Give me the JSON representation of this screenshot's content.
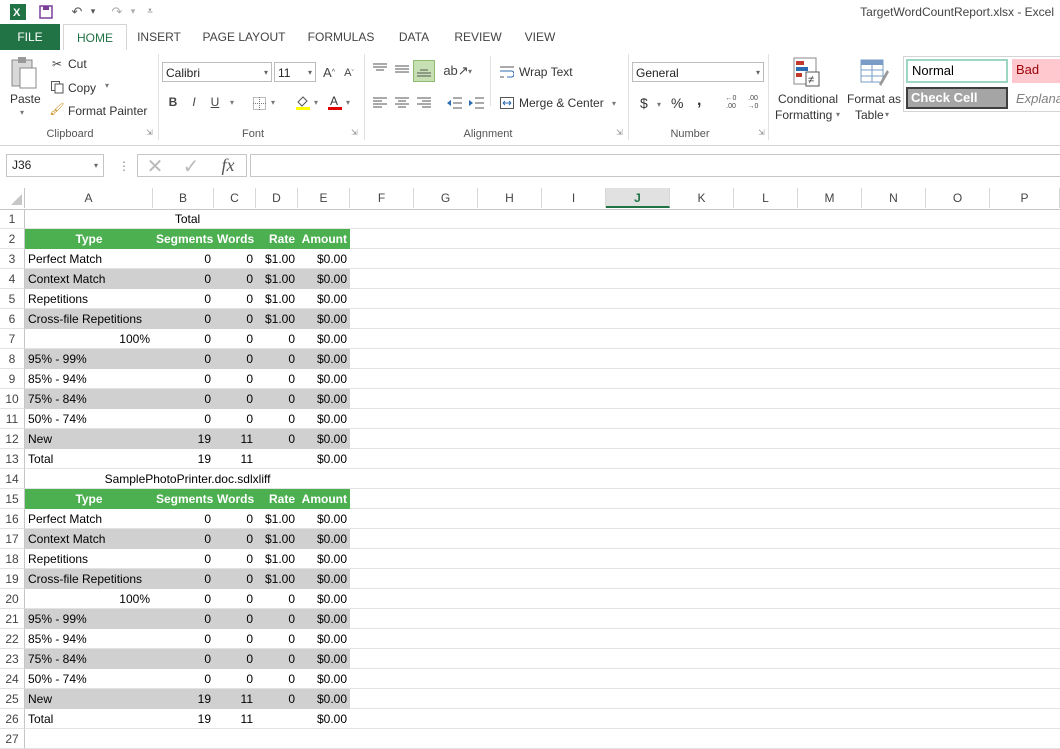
{
  "window": {
    "title": "TargetWordCountReport.xlsx - Excel"
  },
  "tabs": [
    "FILE",
    "HOME",
    "INSERT",
    "PAGE LAYOUT",
    "FORMULAS",
    "DATA",
    "REVIEW",
    "VIEW"
  ],
  "clipboard": {
    "paste": "Paste",
    "cut": "Cut",
    "copy": "Copy",
    "format_painter": "Format Painter",
    "label": "Clipboard"
  },
  "font": {
    "name": "Calibri",
    "size": "11",
    "bold": "B",
    "italic": "I",
    "underline": "U",
    "label": "Font"
  },
  "alignment": {
    "wrap_text": "Wrap Text",
    "merge_center": "Merge & Center",
    "label": "Alignment"
  },
  "number": {
    "format": "General",
    "currency": "$",
    "percent": "%",
    "comma": ",",
    "label": "Number"
  },
  "styles": {
    "conditional": "Conditional",
    "formatting": "Formatting",
    "format_as": "Format as",
    "table": "Table",
    "normal": "Normal",
    "bad": "Bad",
    "check_cell": "Check Cell",
    "explanatory": "Explanatory"
  },
  "formula_bar": {
    "name_box": "J36",
    "fx": "fx",
    "value": ""
  },
  "columns": [
    "A",
    "B",
    "C",
    "D",
    "E",
    "F",
    "G",
    "H",
    "I",
    "J",
    "K",
    "L",
    "M",
    "N",
    "O",
    "P"
  ],
  "selected_column": "J",
  "rows": [
    "1",
    "2",
    "3",
    "4",
    "5",
    "6",
    "7",
    "8",
    "9",
    "10",
    "11",
    "12",
    "13",
    "14",
    "15",
    "16",
    "17",
    "18",
    "19",
    "20",
    "21",
    "22",
    "23",
    "24",
    "25",
    "26",
    "27"
  ],
  "sheet": {
    "section1_title": "Total",
    "section2_title": "SamplePhotoPrinter.doc.sdlxliff",
    "headers": [
      "Type",
      "Segments",
      "Words",
      "Rate",
      "Amount"
    ],
    "section1": [
      [
        "Perfect Match",
        "0",
        "0",
        "$1.00",
        "$0.00"
      ],
      [
        "Context Match",
        "0",
        "0",
        "$1.00",
        "$0.00"
      ],
      [
        "Repetitions",
        "0",
        "0",
        "$1.00",
        "$0.00"
      ],
      [
        "Cross-file Repetitions",
        "0",
        "0",
        "$1.00",
        "$0.00"
      ],
      [
        "100%",
        "0",
        "0",
        "0",
        "$0.00"
      ],
      [
        "95% - 99%",
        "0",
        "0",
        "0",
        "$0.00"
      ],
      [
        "85% - 94%",
        "0",
        "0",
        "0",
        "$0.00"
      ],
      [
        "75% - 84%",
        "0",
        "0",
        "0",
        "$0.00"
      ],
      [
        "50% - 74%",
        "0",
        "0",
        "0",
        "$0.00"
      ],
      [
        "New",
        "19",
        "11",
        "0",
        "$0.00"
      ],
      [
        "Total",
        "19",
        "11",
        "",
        "$0.00"
      ]
    ],
    "section2": [
      [
        "Perfect Match",
        "0",
        "0",
        "$1.00",
        "$0.00"
      ],
      [
        "Context Match",
        "0",
        "0",
        "$1.00",
        "$0.00"
      ],
      [
        "Repetitions",
        "0",
        "0",
        "$1.00",
        "$0.00"
      ],
      [
        "Cross-file Repetitions",
        "0",
        "0",
        "$1.00",
        "$0.00"
      ],
      [
        "100%",
        "0",
        "0",
        "0",
        "$0.00"
      ],
      [
        "95% - 99%",
        "0",
        "0",
        "0",
        "$0.00"
      ],
      [
        "85% - 94%",
        "0",
        "0",
        "0",
        "$0.00"
      ],
      [
        "75% - 84%",
        "0",
        "0",
        "0",
        "$0.00"
      ],
      [
        "50% - 74%",
        "0",
        "0",
        "0",
        "$0.00"
      ],
      [
        "New",
        "19",
        "11",
        "0",
        "$0.00"
      ],
      [
        "Total",
        "19",
        "11",
        "",
        "$0.00"
      ]
    ]
  },
  "colors": {
    "excel_green": "#217346",
    "header_green": "#4caf50",
    "band_gray": "#d0d0d0",
    "bad_fill": "#ffc7ce",
    "check_fill": "#a5a5a5"
  }
}
